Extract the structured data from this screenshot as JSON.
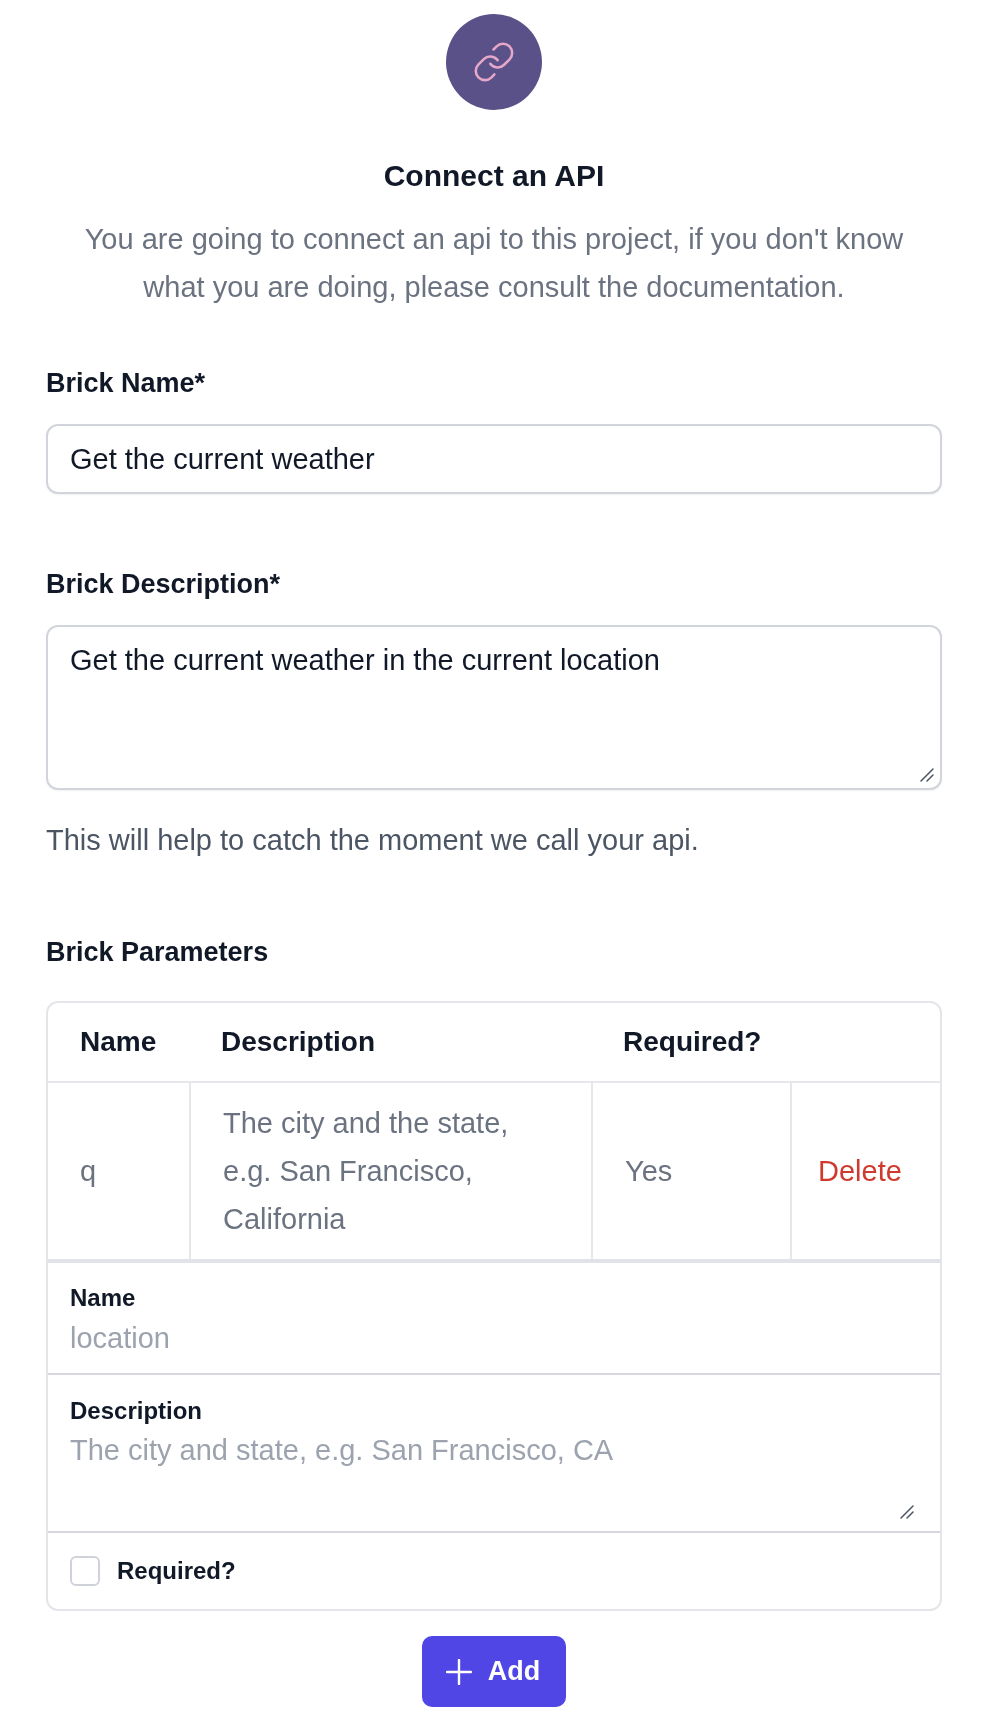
{
  "header": {
    "title": "Connect an API",
    "subtitle": "You are going to connect an api to this project, if you don't know what you are doing, please consult the documentation."
  },
  "fields": [
    {
      "kind": "input",
      "label": "Brick Name*",
      "value": "Get the current weather"
    },
    {
      "kind": "textarea",
      "label": "Brick Description*",
      "value": "Get the current weather in the current location",
      "help": "This will help to catch the moment we call your api."
    }
  ],
  "parameters": {
    "label": "Brick Parameters",
    "columns": [
      "Name",
      "Description",
      "Required?"
    ],
    "rows": [
      {
        "name": "q",
        "description": "The city and the state, e.g. San Francisco, California",
        "required": "Yes",
        "action": "Delete"
      }
    ]
  },
  "new_parameter": {
    "fields": [
      {
        "kind": "input",
        "label": "Name",
        "placeholder": "location"
      },
      {
        "kind": "textarea",
        "label": "Description",
        "placeholder": "The city and state, e.g. San Francisco, CA"
      }
    ],
    "required": {
      "label": "Required?",
      "checked": false
    }
  },
  "add_button": {
    "label": "Add"
  }
}
